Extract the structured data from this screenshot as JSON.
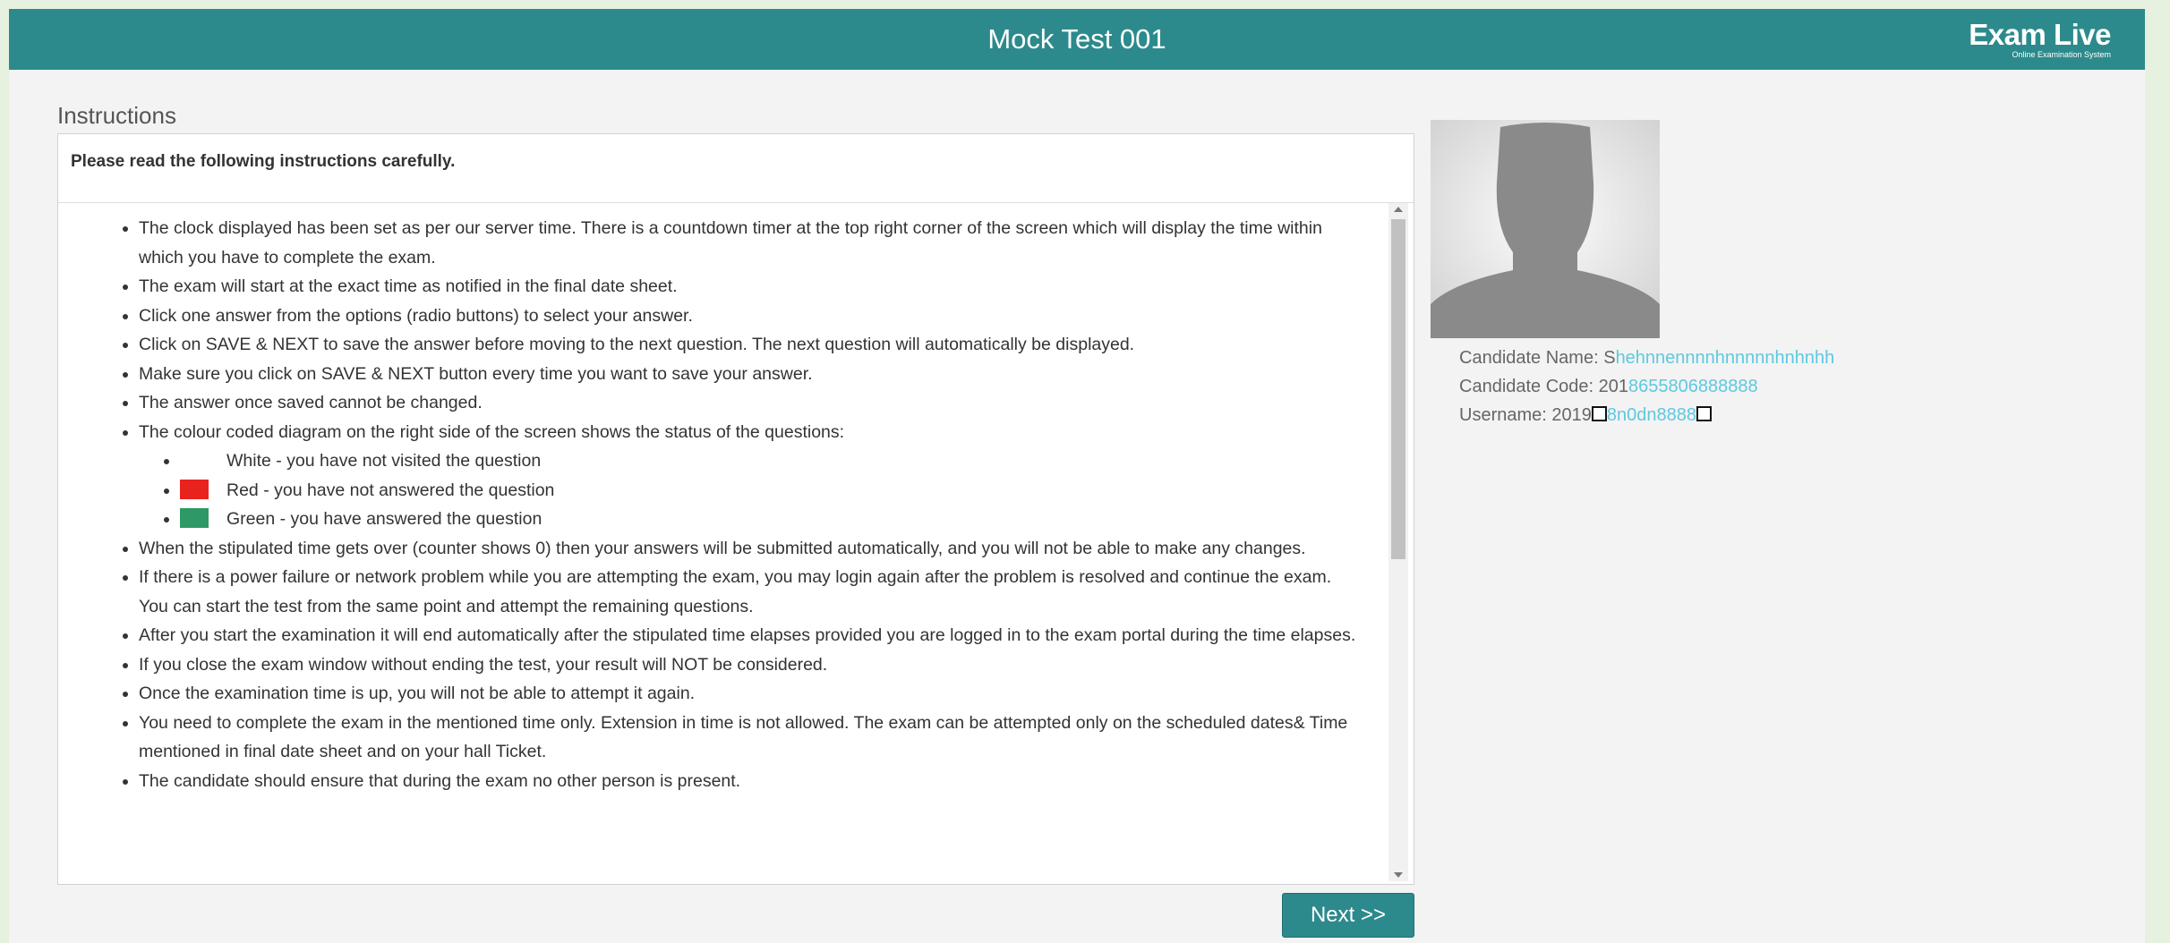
{
  "header": {
    "title": "Mock Test 001",
    "logo_main": "Exam Live",
    "logo_sub": "Online Examination System"
  },
  "instructions": {
    "section_label": "Instructions",
    "heading": "Please read the following instructions carefully.",
    "items_before_legend": [
      "The clock displayed has been set as per our server time. There is a countdown timer at the top right corner of the screen which will display the time within which you have to complete the exam.",
      "The exam will start at the exact time as notified in the final date sheet.",
      "Click one answer from the options (radio buttons) to select your answer.",
      "Click on SAVE & NEXT to save the answer before moving to the next question. The next question will automatically be displayed.",
      "Make sure you click on SAVE & NEXT button every time you want to save your answer.",
      "The answer once saved cannot be changed.",
      "The colour coded diagram on the right side of the screen shows the status of the questions:"
    ],
    "legend": [
      {
        "text": "White - you have not visited the question",
        "color": "#ffffff"
      },
      {
        "text": "Red - you have not answered the question",
        "color": "#e8221d"
      },
      {
        "text": "Green - you have answered the question",
        "color": "#2e9966"
      }
    ],
    "items_after_legend": [
      "When the stipulated time gets over (counter shows 0) then your answers will be submitted automatically, and you will not be able to make any changes.",
      "If there is a power failure or network problem while you are attempting the exam, you may login again after the problem is resolved and continue the exam. You can start the test from the same point and attempt the remaining questions.",
      "After you start the examination it will end automatically after the stipulated time elapses provided you are logged in to the exam portal during the time elapses.",
      "If you close the exam window without ending the test, your result will NOT be considered.",
      "Once the examination time is up, you will not be able to attempt it again.",
      "You need to complete the exam in the mentioned time only. Extension in time is not allowed. The exam can be attempted only on the scheduled dates& Time mentioned in final date sheet and on your hall Ticket.",
      "The candidate should ensure that during the exam no other person is present."
    ]
  },
  "next_button": {
    "label": "Next >>"
  },
  "candidate": {
    "name_label": "Candidate Name:",
    "name_value": "S",
    "name_redacted": "hehnnennnnhnnnnnhnhnhh",
    "code_label": "Candidate Code:",
    "code_value": "201",
    "code_redacted": "8655806888888",
    "username_label": "Username:",
    "username_value": "2019",
    "username_redacted": "8n0dn8888"
  },
  "colors": {
    "header": "#2d8a8c",
    "legend_red": "#e8221d",
    "legend_green": "#2e9966",
    "redacted_text": "#5ec8e0"
  },
  "icons": {
    "avatar": "person-silhouette-icon",
    "scroll_up": "triangle-up-icon",
    "scroll_down": "triangle-down-icon"
  }
}
